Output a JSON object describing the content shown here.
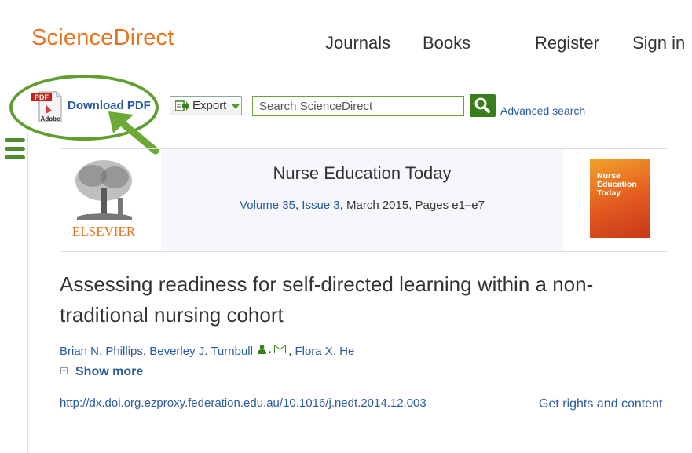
{
  "header": {
    "logo": "ScienceDirect",
    "nav": [
      "Journals",
      "Books",
      "Register",
      "Sign in"
    ]
  },
  "toolbar": {
    "download_pdf": "Download PDF",
    "pdf_badge": "PDF",
    "adobe_badge": "Adobe",
    "export_label": "Export",
    "search_placeholder": "Search ScienceDirect",
    "advanced_search": "Advanced search"
  },
  "journal": {
    "publisher": "ELSEVIER",
    "title": "Nurse Education Today",
    "volume": "Volume 35",
    "issue": "Issue 3",
    "date_pages": ", March 2015, Pages e1–e7",
    "cover_title_lines": [
      "Nurse",
      "Education",
      "Today"
    ]
  },
  "article": {
    "title": "Assessing readiness for self-directed learning within a non-traditional nursing cohort",
    "authors": [
      "Brian N. Phillips",
      "Beverley J. Turnbull",
      "Flora X. He"
    ],
    "show_more": "Show more",
    "doi": "http://dx.doi.org.ezproxy.federation.edu.au/10.1016/j.nedt.2014.12.003",
    "rights": "Get rights and content"
  },
  "colors": {
    "brand": "#e9711c",
    "link": "#2b5aa0",
    "accent_green": "#5f9e2f"
  },
  "icons": [
    "pdf-icon",
    "export-icon",
    "search-icon",
    "menu-icon",
    "person-icon",
    "mail-icon",
    "plus-icon"
  ]
}
